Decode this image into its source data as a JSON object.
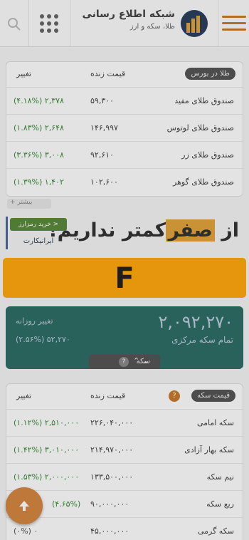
{
  "header": {
    "site_title": "شبکه اطلاع رسانی",
    "site_subtitle": "طلا، سکه و ارز",
    "colors": {
      "menu_accent": "#c77b2c",
      "logo_bg": "#2c3f5c"
    }
  },
  "gold_funds": {
    "tab_label": "طلا در بورس",
    "col_price": "قیمت زنده",
    "col_change": "تغییر",
    "more_label": "+ بیشتر",
    "rows": [
      {
        "name": "صندوق طلای مفید",
        "price": "۵۹,۳۰۰",
        "change": "۲,۳۷۸ (۴.۱۸%)"
      },
      {
        "name": "صندوق طلای لوتوس",
        "price": "۱۴۶,۹۹۷",
        "change": "۲,۶۴۸ (۱.۸۳%)"
      },
      {
        "name": "صندوق طلای زر",
        "price": "۹۲,۶۱۰",
        "change": "۳,۰۰۸ (۳.۳۶%)"
      },
      {
        "name": "صندوق طلای گوهر",
        "price": "۱۰۲,۶۰۰",
        "change": "۱,۴۰۲ (۱.۳۹%)"
      }
    ]
  },
  "ad": {
    "headline_prefix": "از",
    "headline_highlight": "صفر",
    "headline_suffix": "کمتر نداریم!",
    "cta": "خرید رمزارز >",
    "brand": "ایرانیکارت"
  },
  "banner": {
    "letter": "F"
  },
  "coin_summary": {
    "value": "۲,۰۹۲,۲۷۰",
    "label": "تمام سکه مرکزی",
    "daily_label": "تغییر روزانه",
    "daily_value": "(۲.۵۶%) ۵۲,۲۷۰",
    "tab_label": "سکه",
    "help": "?"
  },
  "coin_prices": {
    "tab_label": "قیمت سکه",
    "help": "?",
    "col_price": "قیمت زنده",
    "col_change": "تغییر",
    "rows": [
      {
        "name": "سکه امامی",
        "price": "۲۲۶,۰۴۰,۰۰۰",
        "change": "۲,۵۱۰,۰۰۰ (۱.۱۲%)"
      },
      {
        "name": "سکه بهار آزادی",
        "price": "۲۱۴,۹۷۰,۰۰۰",
        "change": "۳,۰۱۰,۰۰۰ (۱.۴۲%)"
      },
      {
        "name": "نیم سکه",
        "price": "۱۳۳,۵۰۰,۰۰۰",
        "change": "۲,۰۰۰,۰۰۰ (۱.۵۳%)"
      },
      {
        "name": "ربع سکه",
        "price": "۹۰,۰۰۰,۰۰۰",
        "change": "(۴.۶۵%)"
      },
      {
        "name": "سکه گرمی",
        "price": "۴۵,۰۰۰,۰۰۰",
        "change": "۰ (۰%)"
      }
    ]
  }
}
